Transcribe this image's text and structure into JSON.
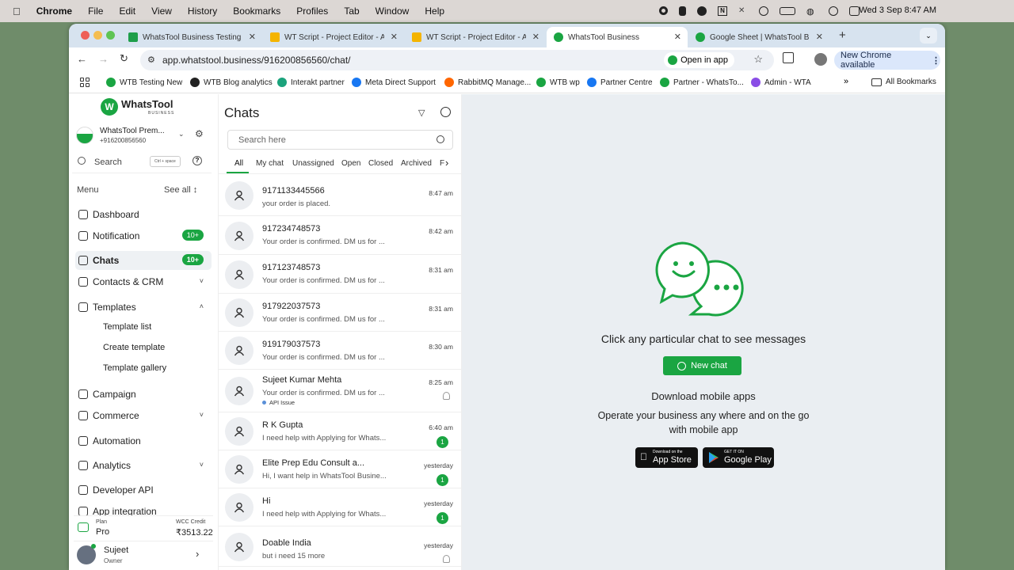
{
  "menubar": {
    "app": "Chrome",
    "items": [
      "File",
      "Edit",
      "View",
      "History",
      "Bookmarks",
      "Profiles",
      "Tab",
      "Window",
      "Help"
    ],
    "clock": "Wed 3 Sep  8:47 AM"
  },
  "tabs": [
    {
      "title": "WhatsTool Business Testing -",
      "icon": "sheets-icon",
      "color": "#1e9e4a"
    },
    {
      "title": "WT Script - Project Editor - A",
      "icon": "apps-script-icon",
      "color": "#f4b400"
    },
    {
      "title": "WT Script - Project Editor - A",
      "icon": "apps-script-icon",
      "color": "#f4b400"
    },
    {
      "title": "WhatsTool Business",
      "icon": "whatstool-icon",
      "color": "#1aa542"
    },
    {
      "title": "Google Sheet | WhatsTool Bus",
      "icon": "whatstool-icon",
      "color": "#1aa542"
    }
  ],
  "toolbar": {
    "url": "app.whatstool.business/916200856560/chat/",
    "open_in_app": "Open in app",
    "new_chrome": "New Chrome available"
  },
  "bookmarks": [
    {
      "label": "WTB Testing New",
      "color": "#1aa542"
    },
    {
      "label": "WTB Blog analytics",
      "color": "#222222"
    },
    {
      "label": "Interakt partner",
      "color": "#1ba37c"
    },
    {
      "label": "Meta Direct Support",
      "color": "#1877f2"
    },
    {
      "label": "RabbitMQ Manage...",
      "color": "#ff6600"
    },
    {
      "label": "WTB wp",
      "color": "#1aa542"
    },
    {
      "label": "Partner Centre",
      "color": "#1877f2"
    },
    {
      "label": "Partner - WhatsTo...",
      "color": "#1aa542"
    },
    {
      "label": "Admin - WTA",
      "color": "#8a4de6"
    }
  ],
  "all_bookmarks": "All Bookmarks",
  "sidebar": {
    "logo_text": "WhatsTool",
    "logo_sub": "BUSINESS",
    "account_name": "WhatsTool Prem...",
    "account_phone": "+916200856560",
    "search_placeholder": "Search",
    "search_shortcut": "Ctrl + space",
    "menu_label": "Menu",
    "see_all": "See all",
    "items": [
      {
        "label": "Dashboard",
        "icon": "dashboard-icon"
      },
      {
        "label": "Notification",
        "icon": "bell-icon",
        "badge": "10+"
      },
      {
        "label": "Chats",
        "icon": "chat-icon",
        "badge": "10+"
      },
      {
        "label": "Contacts & CRM",
        "icon": "contacts-icon"
      },
      {
        "label": "Templates",
        "icon": "templates-icon"
      },
      {
        "label": "Campaign",
        "icon": "megaphone-icon"
      },
      {
        "label": "Commerce",
        "icon": "cart-icon"
      },
      {
        "label": "Automation",
        "icon": "robot-icon"
      },
      {
        "label": "Analytics",
        "icon": "analytics-icon"
      },
      {
        "label": "Developer API",
        "icon": "api-icon"
      },
      {
        "label": "App integration",
        "icon": "integration-icon"
      }
    ],
    "template_sub": [
      "Template list",
      "Create template",
      "Template gallery"
    ],
    "plan_label": "Plan",
    "plan_value": "Pro",
    "credit_label": "WCC Credit",
    "credit_value": "₹3513.22",
    "user_name": "Sujeet",
    "user_role": "Owner"
  },
  "chatlist": {
    "title": "Chats",
    "search_placeholder": "Search here",
    "filters": [
      "All",
      "My chat",
      "Unassigned",
      "Open",
      "Closed",
      "Archived",
      "F"
    ],
    "chats": [
      {
        "name": "9171133445566",
        "preview": "your order is placed.",
        "time": "8:47 am"
      },
      {
        "name": "917234748573",
        "preview": "Your order is confirmed. DM us for ...",
        "time": "8:42 am"
      },
      {
        "name": "917123748573",
        "preview": "Your order is confirmed. DM us for ...",
        "time": "8:31 am"
      },
      {
        "name": "917922037573",
        "preview": "Your order is confirmed. DM us for ...",
        "time": "8:31 am"
      },
      {
        "name": "919179037573",
        "preview": "Your order is confirmed. DM us for ...",
        "time": "8:30 am"
      },
      {
        "name": "Sujeet Kumar Mehta",
        "preview": "Your order is confirmed. DM us for ...",
        "time": "8:25 am",
        "tag": "API Issue"
      },
      {
        "name": "R K Gupta",
        "preview": "I need help with Applying for Whats...",
        "time": "6:40 am",
        "unread": "1"
      },
      {
        "name": "Elite Prep Edu Consult a...",
        "preview": "Hi, I want help in WhatsTool Busine...",
        "time": "yesterday",
        "unread": "1"
      },
      {
        "name": "Hi",
        "preview": "I need help with Applying for Whats...",
        "time": "yesterday",
        "unread": "1"
      },
      {
        "name": "Doable India",
        "preview": "but i need 15 more",
        "time": "yesterday"
      }
    ]
  },
  "detail": {
    "prompt": "Click any particular chat to see messages",
    "new_chat": "New chat",
    "download_title": "Download mobile apps",
    "download_desc": "Operate your business any where and on the go with mobile app",
    "app_store_small": "Download on the",
    "app_store_big": "App Store",
    "play_small": "GET IT ON",
    "play_big": "Google Play"
  },
  "colors": {
    "brand_green": "#1aa542",
    "tab_bg": "#d7e3ef",
    "detail_bg": "#eaeef2"
  }
}
